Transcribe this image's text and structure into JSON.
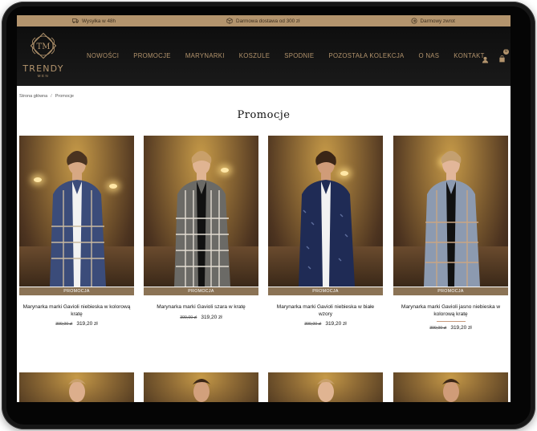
{
  "topbar": {
    "items": [
      {
        "label": "Wysyłka w 48h",
        "icon": "truck-icon"
      },
      {
        "label": "Darmowa dostawa od 300 zł",
        "icon": "box-icon"
      },
      {
        "label": "Darmowy zwrot",
        "icon": "return-icon"
      }
    ]
  },
  "header": {
    "logo_monogram": "TM",
    "logo_name": "TRENDY",
    "logo_sub": "MEN",
    "nav": [
      "NOWOŚCI",
      "PROMOCJE",
      "MARYNARKI",
      "KOSZULE",
      "SPODNIE",
      "POZOSTAŁA KOLEKCJA",
      "O NAS",
      "KONTAKT"
    ],
    "cart_count": "0"
  },
  "breadcrumb": [
    "Strona główna",
    "Promocje"
  ],
  "page_title": "Promocje",
  "badge_label": "PROMOCJA",
  "products": [
    {
      "name": "Marynarka marki Gavioli niebieska w kolorową kratę",
      "old_price": "399,00 zł",
      "price": "319,20 zł",
      "jacket": "#3b4c7a",
      "check": "#c9b9a0"
    },
    {
      "name": "Marynarka marki Gavioli szara w kratę",
      "old_price": "399,00 zł",
      "price": "319,20 zł",
      "jacket": "#6b6a66",
      "check": "#e3ddd2"
    },
    {
      "name": "Marynarka marki Gavioli niebieska w białe wzory",
      "old_price": "399,00 zł",
      "price": "319,20 zł",
      "jacket": "#1f2b55",
      "check": "#5f6f9e"
    },
    {
      "name": "Marynarka marki Gavioli jasno niebieska w kolorową kratę",
      "old_price": "399,00 zł",
      "price": "319,20 zł",
      "jacket": "#8c9ab0",
      "check": "#c9a583"
    }
  ]
}
